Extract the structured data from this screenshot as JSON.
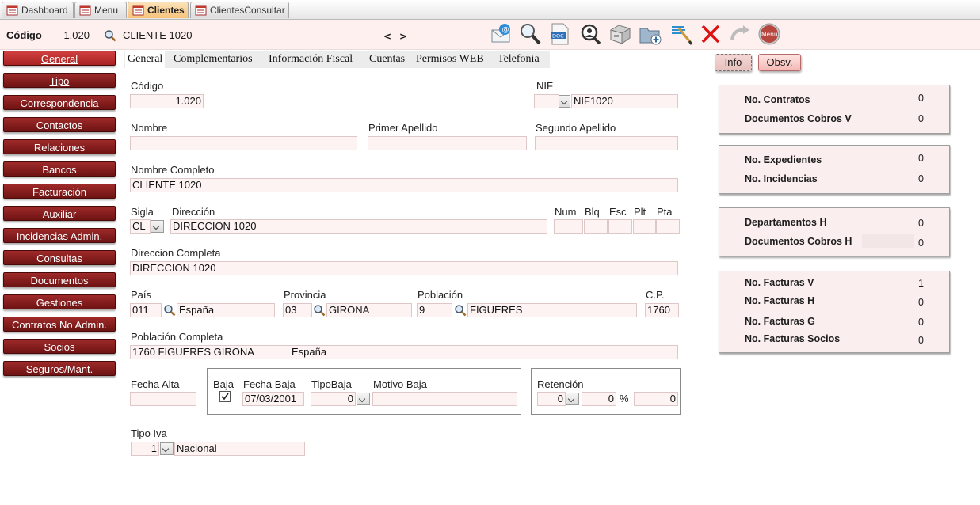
{
  "tabs": [
    {
      "label": "Dashboard",
      "active": false
    },
    {
      "label": "Menu",
      "active": false
    },
    {
      "label": "Clientes",
      "active": true
    },
    {
      "label": "ClientesConsultar",
      "active": false
    }
  ],
  "header": {
    "codigo_label": "Código",
    "codigo_value": "1.020",
    "client_name": "CLIENTE 1020",
    "prev": "<",
    "next": ">",
    "menu_icon_label": "Menu"
  },
  "toolbar_icons": [
    "email-icon",
    "search-icon",
    "doc-icon",
    "find-icon",
    "archive-icon",
    "folder-add-icon",
    "edit-icon",
    "delete-icon",
    "undo-icon",
    "menu-icon"
  ],
  "sidebar": [
    {
      "label": "General",
      "active": true
    },
    {
      "label": "Tipo",
      "active": false
    },
    {
      "label": "Correspondencia",
      "active": false
    },
    {
      "label": "Contactos",
      "active": false
    },
    {
      "label": "Relaciones",
      "active": false
    },
    {
      "label": "Bancos",
      "active": false
    },
    {
      "label": "Facturación",
      "active": false
    },
    {
      "label": "Auxiliar",
      "active": false
    },
    {
      "label": "Incidencias Admin.",
      "active": false
    },
    {
      "label": "Consultas",
      "active": false
    },
    {
      "label": "Documentos",
      "active": false
    },
    {
      "label": "Gestiones",
      "active": false
    },
    {
      "label": "Contratos No Admin.",
      "active": false
    },
    {
      "label": "Socios",
      "active": false
    },
    {
      "label": "Seguros/Mant.",
      "active": false
    }
  ],
  "form_tabs": [
    {
      "label": "General",
      "active": true
    },
    {
      "label": "Complementarios",
      "active": false
    },
    {
      "label": "Información Fiscal",
      "active": false
    },
    {
      "label": "Cuentas",
      "active": false
    },
    {
      "label": "Permisos WEB",
      "active": false
    },
    {
      "label": "Telefonia",
      "active": false
    }
  ],
  "form": {
    "codigo": {
      "label": "Código",
      "value": "1.020"
    },
    "nif": {
      "label": "NIF",
      "type_value": "",
      "value": "NIF1020"
    },
    "nombre": {
      "label": "Nombre",
      "value": ""
    },
    "primer_apellido": {
      "label": "Primer Apellido",
      "value": ""
    },
    "segundo_apellido": {
      "label": "Segundo Apellido",
      "value": ""
    },
    "nombre_completo": {
      "label": "Nombre Completo",
      "value": "CLIENTE 1020"
    },
    "sigla": {
      "label": "Sigla",
      "value": "CL"
    },
    "direccion": {
      "label": "Dirección",
      "value": "DIRECCION 1020"
    },
    "num": {
      "label": "Num",
      "value": ""
    },
    "blq": {
      "label": "Blq",
      "value": ""
    },
    "esc": {
      "label": "Esc",
      "value": ""
    },
    "plt": {
      "label": "Plt",
      "value": ""
    },
    "pta": {
      "label": "Pta",
      "value": ""
    },
    "direccion_completa": {
      "label": "Direccion Completa",
      "value": "DIRECCION 1020"
    },
    "pais": {
      "label": "País",
      "code": "011",
      "name": "España"
    },
    "provincia": {
      "label": "Provincia",
      "code": "03",
      "name": "GIRONA"
    },
    "poblacion": {
      "label": "Población",
      "code": "9",
      "name": "FIGUERES"
    },
    "cp": {
      "label": "C.P.",
      "value": "1760"
    },
    "poblacion_completa": {
      "label": "Población Completa",
      "value": "1760 FIGUERES GIRONA",
      "country": "España"
    },
    "fecha_alta": {
      "label": "Fecha Alta",
      "value": ""
    },
    "baja": {
      "label": "Baja",
      "checked": true
    },
    "fecha_baja": {
      "label": "Fecha Baja",
      "value": "07/03/2001"
    },
    "tipo_baja": {
      "label": "TipoBaja",
      "value": "0"
    },
    "motivo_baja": {
      "label": "Motivo Baja",
      "value": ""
    },
    "retencion": {
      "label": "Retención",
      "type_value": "0",
      "value": "0",
      "percent": "%",
      "amount": "0"
    },
    "tipo_iva": {
      "label": "Tipo Iva",
      "code": "1",
      "name": "Nacional"
    }
  },
  "right_panel": {
    "info_button": "Info",
    "obsv_button": "Obsv.",
    "cards": [
      {
        "rows": [
          {
            "label": "No. Contratos",
            "value": "0"
          },
          {
            "label": "Documentos Cobros V",
            "value": "0"
          }
        ]
      },
      {
        "rows": [
          {
            "label": "No. Expedientes",
            "value": "0"
          },
          {
            "label": "No. Incidencias",
            "value": "0"
          }
        ]
      },
      {
        "rows": [
          {
            "label": "Departamentos H",
            "value": "0"
          },
          {
            "label": "Documentos Cobros H",
            "value": "0"
          }
        ]
      },
      {
        "rows": [
          {
            "label": "No. Facturas V",
            "value": "1"
          },
          {
            "label": "No. Facturas H",
            "value": "0"
          },
          {
            "label": "No. Facturas G",
            "value": "0"
          },
          {
            "label": "No. Facturas Socios",
            "value": "0"
          }
        ]
      }
    ]
  }
}
